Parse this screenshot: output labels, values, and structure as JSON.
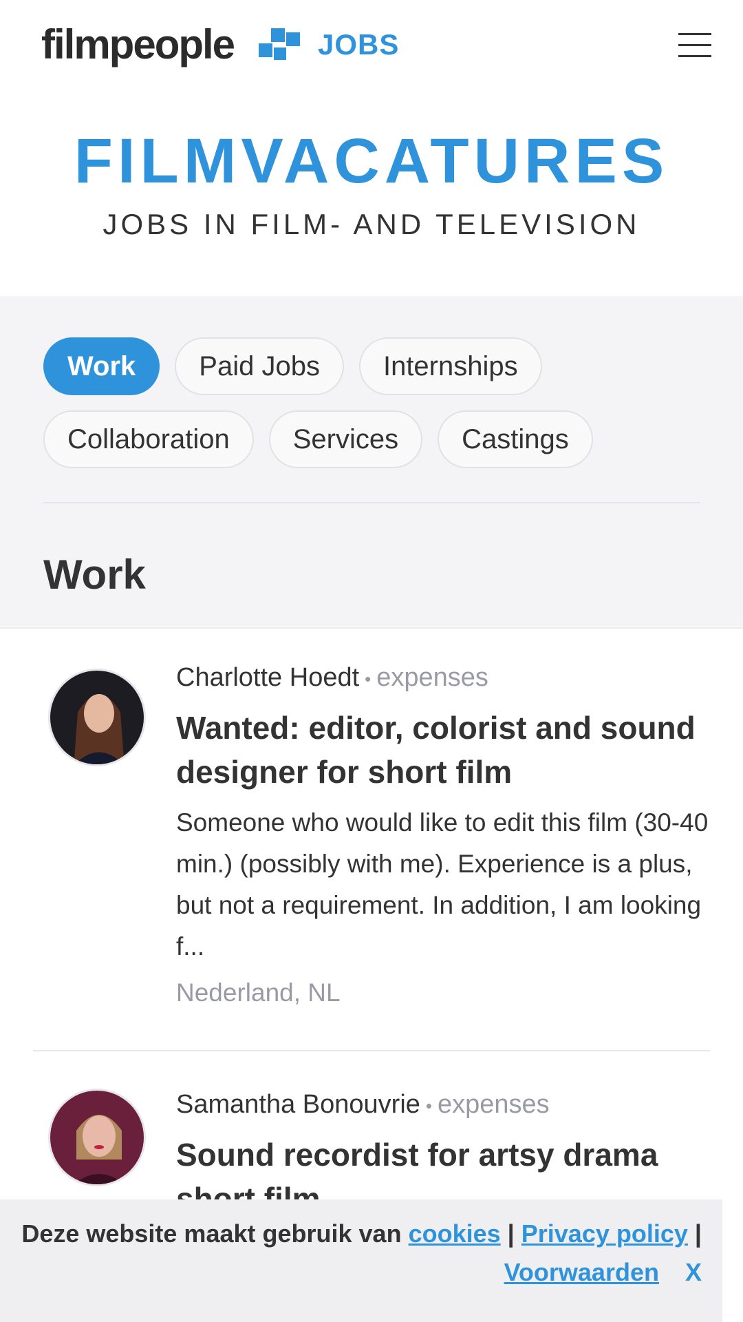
{
  "header": {
    "brand": "filmpeople",
    "jobs_label": "JOBS"
  },
  "hero": {
    "title": "FILMVACATURES",
    "subtitle": "JOBS IN FILM- AND TELEVISION"
  },
  "filters": {
    "row1": [
      "Work",
      "Paid Jobs",
      "Internships"
    ],
    "row2": [
      "Collaboration",
      "Services",
      "Castings"
    ],
    "active": "Work"
  },
  "section": {
    "title": "Work"
  },
  "posts": [
    {
      "author": "Charlotte Hoedt",
      "tag": "expenses",
      "title": "Wanted: editor, colorist and sound designer for short film",
      "description": "Someone who would like to edit this film (30-40 min.) (possibly with me). Experience is a plus, but not a requirement. In addition, I am looking f...",
      "location": "Nederland, NL"
    },
    {
      "author": "Samantha Bonouvrie",
      "tag": "expenses",
      "title": "Sound recordist for artsy drama short film"
    }
  ],
  "cookie": {
    "text": "Deze website maakt gebruik van",
    "link_cookies": "cookies",
    "sep": "|",
    "link_privacy": "Privacy policy",
    "link_terms": "Voorwaarden",
    "close": "X"
  },
  "colors": {
    "accent": "#2f93dc",
    "bg_gray": "#f4f4f6",
    "text": "#333333",
    "muted": "#9a9aa5"
  }
}
